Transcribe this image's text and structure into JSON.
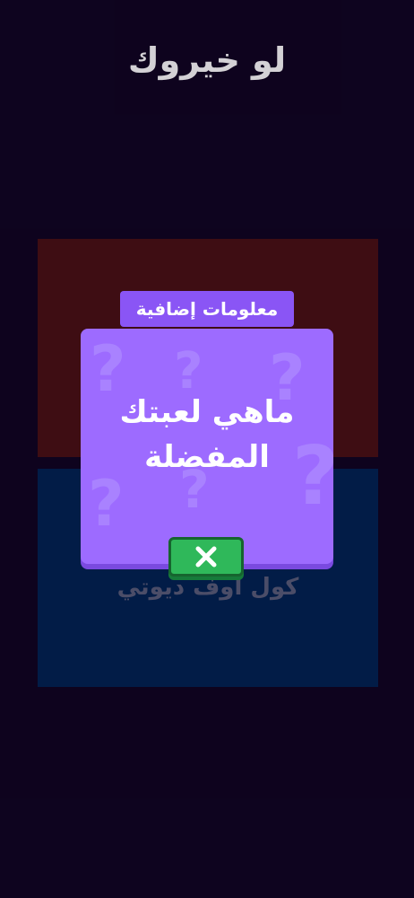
{
  "header": {
    "title": "لو خيروك"
  },
  "options": {
    "red": {
      "label": ""
    },
    "blue": {
      "label": "كول اوف ديوتي"
    }
  },
  "modal": {
    "label": "معلومات إضافية",
    "question": "ماهي لعبتك المفضلة",
    "close_icon": "close-icon"
  },
  "colors": {
    "background": "#0f0420",
    "option_red": "#4a1013",
    "option_blue": "#012352",
    "modal_purple": "#9d6bff",
    "close_green": "#2fb85a"
  }
}
